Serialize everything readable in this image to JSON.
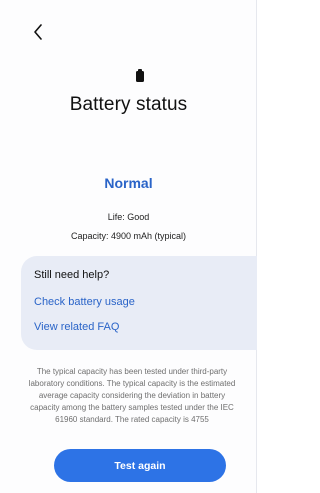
{
  "header": {
    "back_icon": "chevron-left-icon"
  },
  "battery": {
    "icon": "battery-icon",
    "title": "Battery status",
    "status": "Normal",
    "life": "Life: Good",
    "capacity": "Capacity: 4900 mAh (typical)"
  },
  "help": {
    "title": "Still need help?",
    "links": [
      {
        "label": "Check battery usage"
      },
      {
        "label": "View related FAQ"
      }
    ]
  },
  "disclaimer": "The typical capacity has been tested under third-party laboratory conditions. The typical capacity is the estimated average capacity considering the deviation in battery capacity among the battery samples tested under the IEC 61960 standard. The rated capacity is 4755",
  "actions": {
    "test_again_label": "Test again"
  },
  "colors": {
    "accent": "#2a64c8",
    "button": "#2d73e6",
    "card": "#e8ecf6"
  }
}
